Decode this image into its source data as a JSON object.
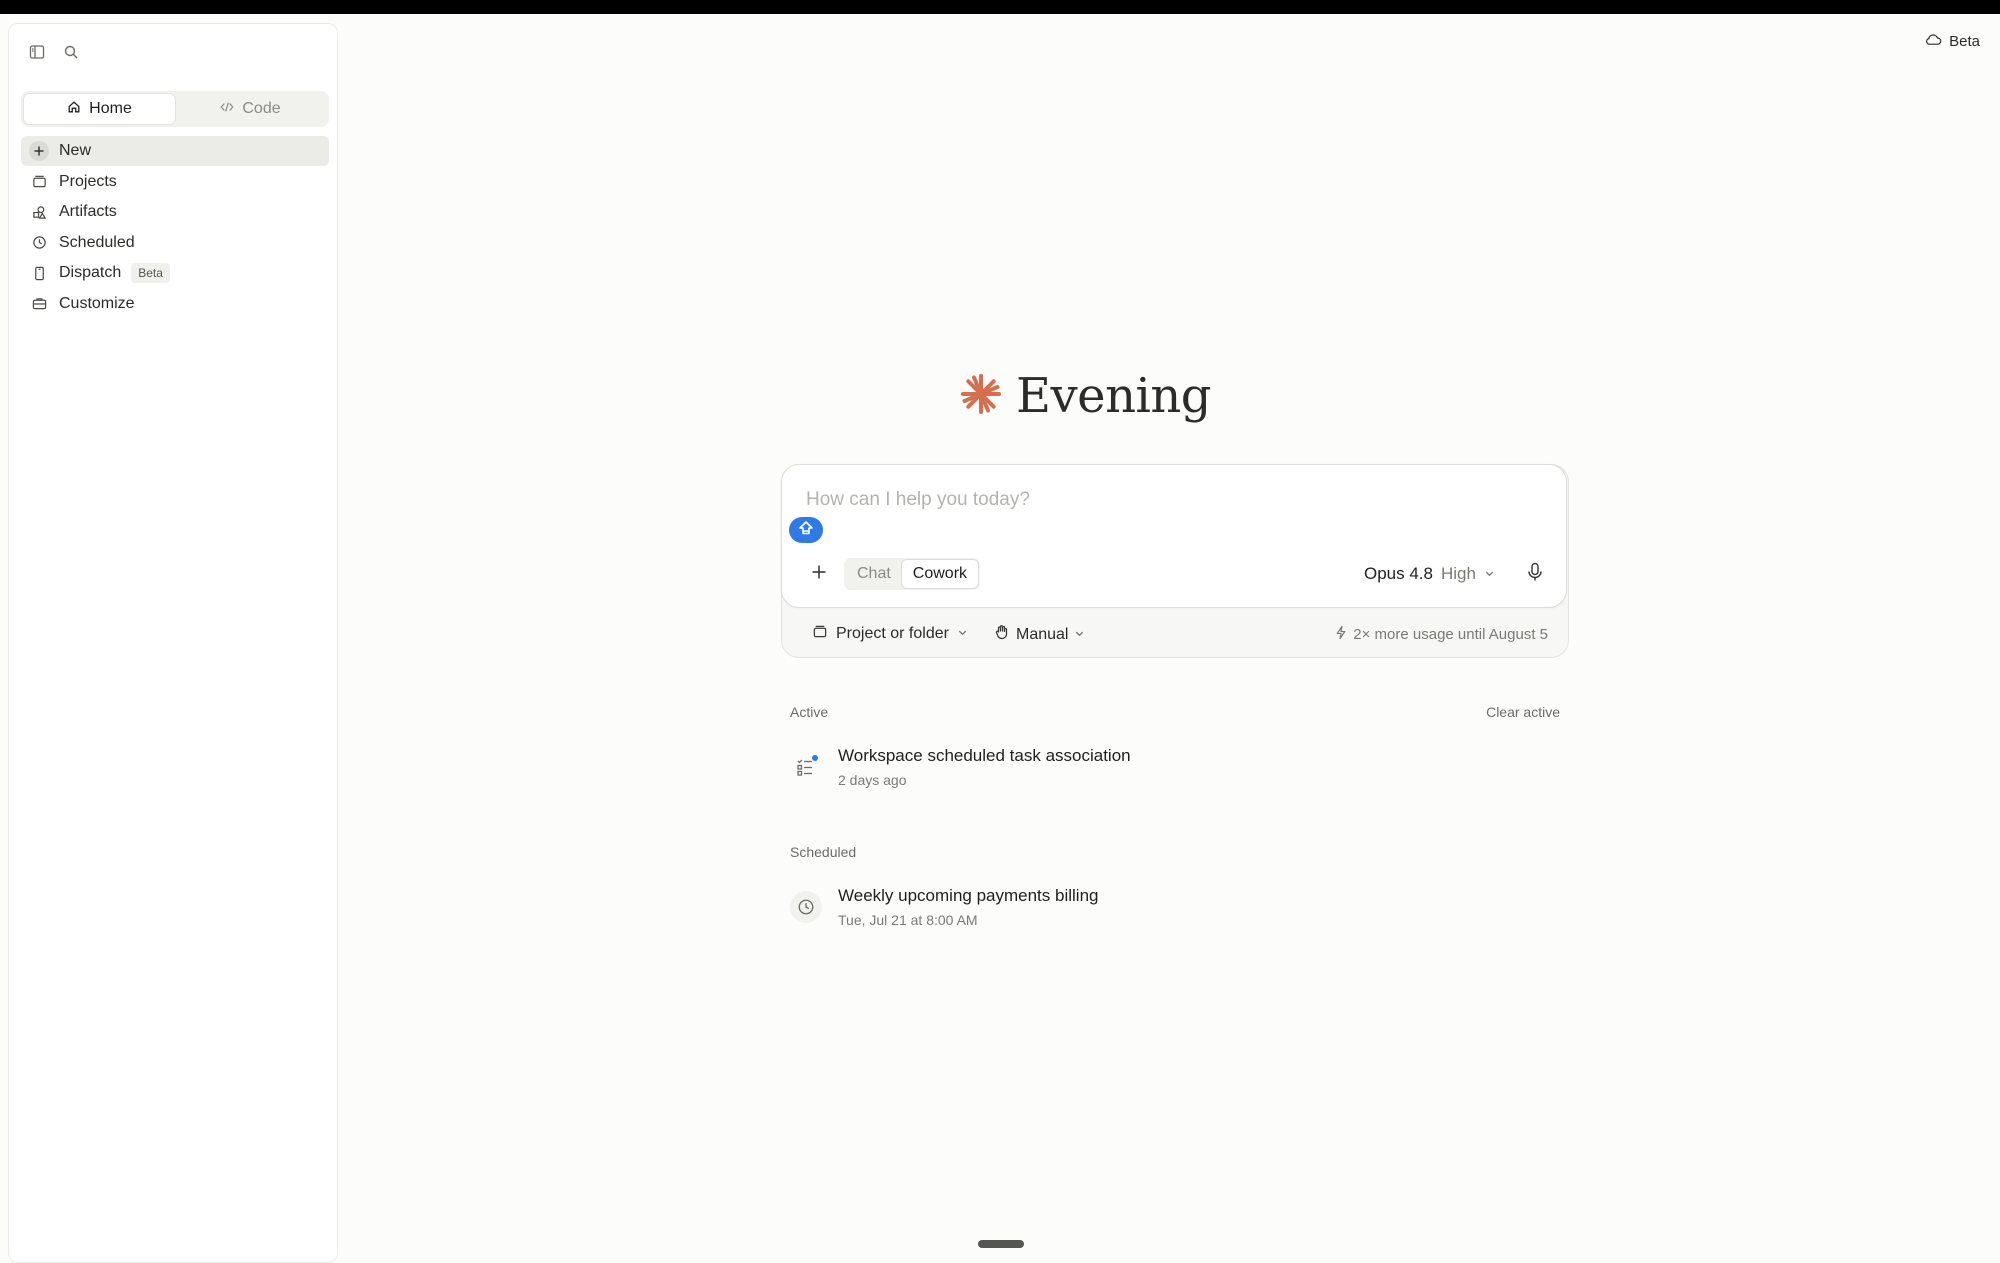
{
  "sidebar": {
    "tabs": [
      {
        "label": "Home",
        "icon": "home-icon"
      },
      {
        "label": "Code",
        "icon": "code-icon"
      }
    ],
    "items": [
      {
        "label": "New",
        "icon": "plus-icon"
      },
      {
        "label": "Projects",
        "icon": "folder-icon"
      },
      {
        "label": "Artifacts",
        "icon": "shapes-icon"
      },
      {
        "label": "Scheduled",
        "icon": "clock-icon"
      },
      {
        "label": "Dispatch",
        "icon": "phone-icon",
        "badge": "Beta"
      },
      {
        "label": "Customize",
        "icon": "briefcase-icon"
      }
    ]
  },
  "header": {
    "beta_label": "Beta"
  },
  "greeting": "Evening",
  "composer": {
    "placeholder": "How can I help you today?",
    "modes": [
      "Chat",
      "Cowork"
    ],
    "active_mode": "Cowork",
    "model": "Opus 4.8",
    "effort": "High",
    "project_label": "Project or folder",
    "permission_label": "Manual",
    "usage_note": "2× more usage until August 5"
  },
  "active": {
    "heading": "Active",
    "clear_label": "Clear active",
    "items": [
      {
        "title": "Workspace scheduled task association",
        "subtitle": "2 days ago"
      }
    ]
  },
  "scheduled": {
    "heading": "Scheduled",
    "items": [
      {
        "title": "Weekly upcoming payments billing",
        "subtitle": "Tue, Jul 21 at 8:00 AM"
      }
    ]
  },
  "colors": {
    "accent": "#2f7ae5",
    "brand": "#d4704f"
  }
}
